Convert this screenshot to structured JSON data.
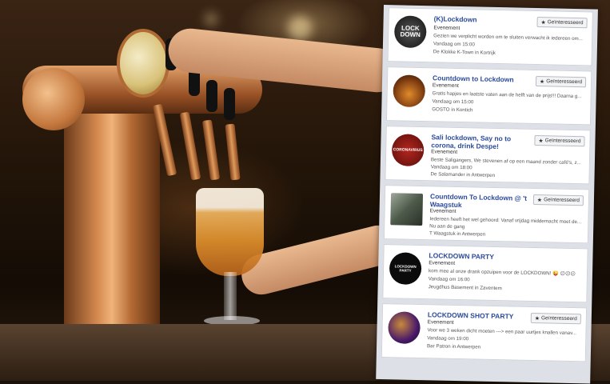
{
  "events": [
    {
      "title": "(K)Lockdown",
      "type": "Evenement",
      "description": "Gezien we verplicht worden om te sluiten verwacht ik iedereen om...",
      "date": "Vandaag om 15:00",
      "location": "De Klokke K-Town in Kortrijk",
      "button": "Geïnteresseerd",
      "thumb_text": "LOCK DOWN",
      "thumb_icon": "lockdown-logo-icon"
    },
    {
      "title": "Countdown to Lockdown",
      "type": "Evenement",
      "description": "Gratis hapjes en laatste vaten aan de helft van de prijs!!! Daarna g...",
      "date": "Vandaag om 15:00",
      "location": "GOSTO in Kontich",
      "button": "Geïnteresseerd",
      "thumb_icon": "beer-glasses-icon"
    },
    {
      "title": "Sali lockdown, Say no to corona, drink Despe!",
      "type": "Evenement",
      "description": "Beste Saligangers, We stevenen af op een maand zonder café's, z...",
      "date": "Vandaag om 18:00",
      "location": "De Salamander in Antwerpen",
      "button": "Geïnteresseerd",
      "thumb_text": "CORONAVIRUS",
      "thumb_icon": "coronavirus-image-icon"
    },
    {
      "title": "Countdown To Lockdown @ 't Waagstuk",
      "type": "Evenement",
      "description": "Iedereen heeft het wel gehoord: Vanaf vrijdag middernacht moet de...",
      "description2": "Nu aan de gang",
      "location": "T Waagstuk in Antwerpen",
      "button": "Geïnteresseerd",
      "thumb_icon": "bar-interior-icon"
    },
    {
      "title": "LOCKDOWN PARTY",
      "type": "Evenement",
      "description": "kom mee al onze drank opzuipen voor de LOCKDOWN! 😜 ☹☹☹",
      "date": "Vandaag om 16:00",
      "location": "Jeugdhus Basement in Zaventem",
      "button": "",
      "thumb_text": "LOCKDOWN PARTY",
      "thumb_icon": "party-logo-icon"
    },
    {
      "title": "LOCKDOWN SHOT PARTY",
      "type": "Evenement",
      "description": "Voor we 3 weken dicht moeten ---> een paar uurtjes knallen vanav...",
      "date": "Vandaag om 19:00",
      "location": "Bar Patron in Antwerpen",
      "button": "Geïnteresseerd",
      "thumb_icon": "shot-glasses-icon"
    }
  ],
  "colors": {
    "title_blue": "#2b4a9a",
    "card_bg": "#ffffff",
    "panel_bg": "#dde0e6"
  }
}
